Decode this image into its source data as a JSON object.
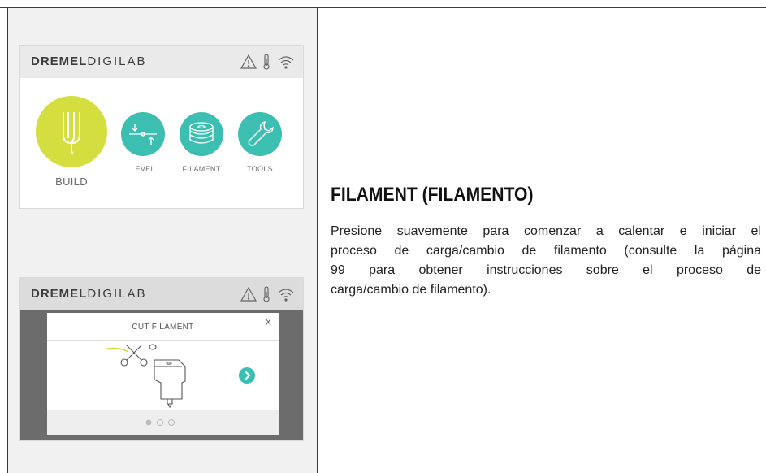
{
  "home_screen": {
    "brand_bold": "DREMEL",
    "brand_light": "DIGILAB",
    "buttons": [
      {
        "label": "BUILD",
        "icon": "extruder-icon",
        "color": "#d4df3f"
      },
      {
        "label": "LEVEL",
        "icon": "level-icon",
        "color": "#3cbfb0"
      },
      {
        "label": "FILAMENT",
        "icon": "filament-spool-icon",
        "color": "#3cbfb0"
      },
      {
        "label": "TOOLS",
        "icon": "wrench-icon",
        "color": "#3cbfb0"
      }
    ],
    "status_icons": [
      "warning-icon",
      "thermometer-icon",
      "wifi-icon"
    ]
  },
  "filament_screen": {
    "brand_bold": "DREMEL",
    "brand_light": "DIGILAB",
    "dialog_title": "CUT FILAMENT",
    "close_label": "X",
    "page_dots": 3,
    "active_dot": 1
  },
  "section": {
    "heading": "FILAMENT (FILAMENTO)",
    "body_lines": [
      "Presione suavemente para comenzar a calentar e iniciar el",
      "proceso de carga/cambio de filamento (consulte la página",
      "99 para obtener instrucciones sobre el proceso de",
      "carga/cambio de filamento)."
    ]
  },
  "colors": {
    "lime": "#d4df3f",
    "teal": "#3cbfb0",
    "overlay": "#6c6c6c"
  }
}
